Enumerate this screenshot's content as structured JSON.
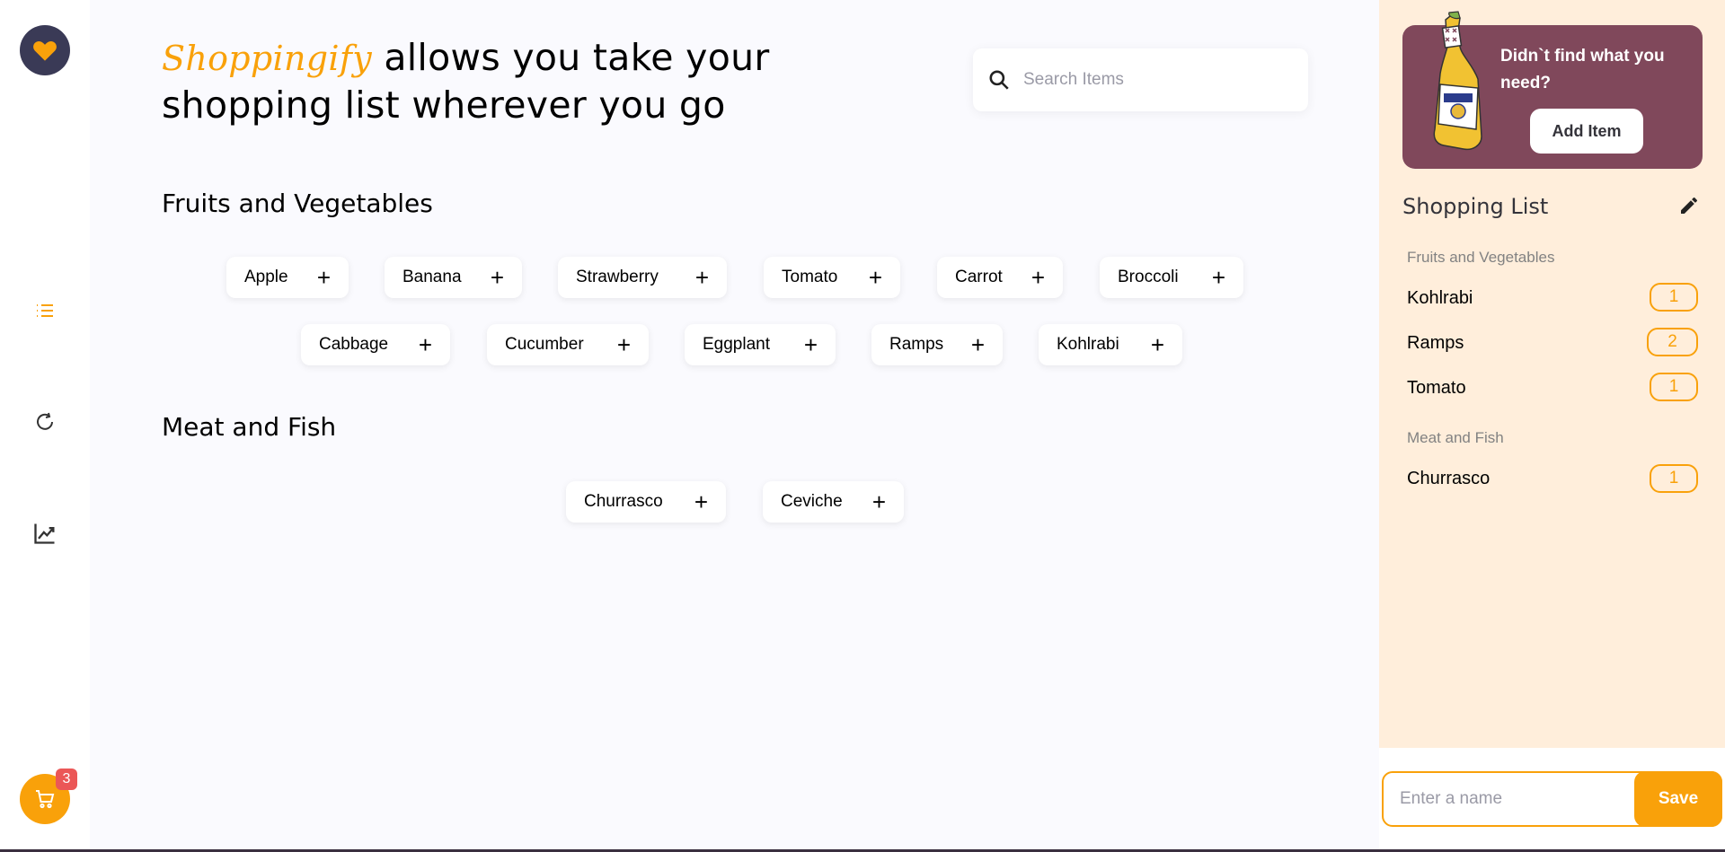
{
  "app": {
    "brand": "Shoppingify",
    "headline_rest": " allows you take your shopping list wherever you go"
  },
  "search": {
    "placeholder": "Search Items"
  },
  "nav": {
    "items": [
      "list-icon",
      "history-icon",
      "statistics-icon"
    ],
    "cart_count": "3"
  },
  "sections": [
    {
      "title": "Fruits and Vegetables",
      "items": [
        "Apple",
        "Banana",
        "Strawberry",
        "Tomato",
        "Carrot",
        "Broccoli",
        "Cabbage",
        "Cucumber",
        "Eggplant",
        "Ramps",
        "Kohlrabi"
      ]
    },
    {
      "title": "Meat and Fish",
      "items": [
        "Churrasco",
        "Ceviche"
      ]
    }
  ],
  "chip_plus": "+",
  "promo": {
    "text": "Didn`t find what you need?",
    "button": "Add Item"
  },
  "shopping_list": {
    "title": "Shopping List",
    "categories": [
      {
        "name": "Fruits and Vegetables",
        "items": [
          {
            "name": "Kohlrabi",
            "qty": "1"
          },
          {
            "name": "Ramps",
            "qty": "2"
          },
          {
            "name": "Tomato",
            "qty": "1"
          }
        ]
      },
      {
        "name": "Meat and Fish",
        "items": [
          {
            "name": "Churrasco",
            "qty": "1"
          }
        ]
      }
    ]
  },
  "save": {
    "placeholder": "Enter a name",
    "button": "Save"
  },
  "colors": {
    "accent": "#f9a10a",
    "promo_bg": "#80485b",
    "panel_bg": "#ffeedb",
    "logo_bg": "#3a3a56",
    "badge": "#eb5757"
  }
}
